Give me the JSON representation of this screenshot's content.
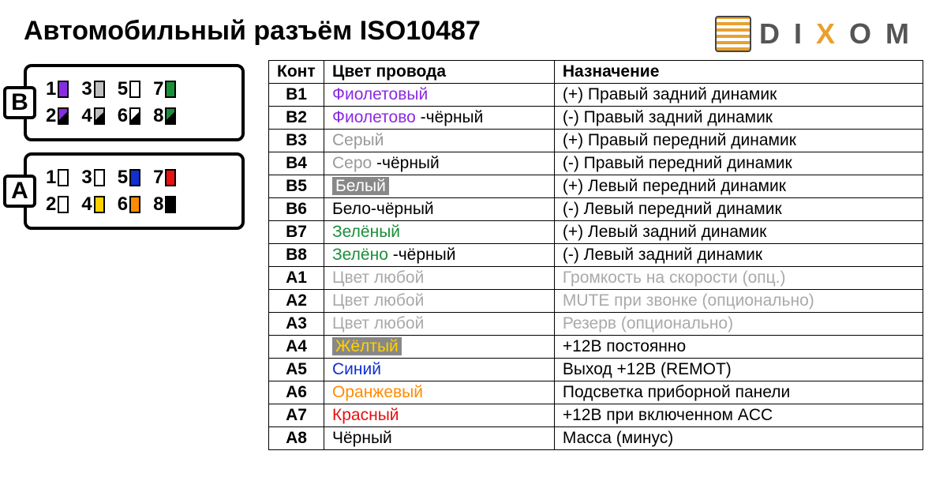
{
  "title": "Автомобильный разъём ISO10487",
  "brand": {
    "d": "D",
    "i": "I",
    "x": "X",
    "o": "O",
    "m": "M"
  },
  "connectors": {
    "B": {
      "label": "B",
      "row1": [
        {
          "n": "1",
          "fill": "#8a2be2"
        },
        {
          "n": "3",
          "fill": "#bfbfbf"
        },
        {
          "n": "5",
          "fill": "#ffffff"
        },
        {
          "n": "7",
          "fill": "#1a8f3a"
        }
      ],
      "row2": [
        {
          "n": "2",
          "fill": "#8a2be2",
          "half": "#000"
        },
        {
          "n": "4",
          "fill": "#bfbfbf",
          "half": "#000"
        },
        {
          "n": "6",
          "fill": "#ffffff",
          "half": "#000"
        },
        {
          "n": "8",
          "fill": "#1a8f3a",
          "half": "#000"
        }
      ]
    },
    "A": {
      "label": "A",
      "row1": [
        {
          "n": "1",
          "fill": "#ffffff"
        },
        {
          "n": "3",
          "fill": "#ffffff"
        },
        {
          "n": "5",
          "fill": "#1030d0"
        },
        {
          "n": "7",
          "fill": "#e81010"
        }
      ],
      "row2": [
        {
          "n": "2",
          "fill": "#ffffff"
        },
        {
          "n": "4",
          "fill": "#ffd000"
        },
        {
          "n": "6",
          "fill": "#ff8c00"
        },
        {
          "n": "8",
          "fill": "#000000"
        }
      ]
    }
  },
  "table": {
    "headers": {
      "pin": "Конт",
      "color": "Цвет провода",
      "func": "Назначение"
    },
    "rows": [
      {
        "pin": "B1",
        "color_html": "<span style='color:#8a2be2'>Фиолетовый</span>",
        "func": "(+) Правый задний динамик"
      },
      {
        "pin": "B2",
        "color_html": "<span style='color:#8a2be2'>Фиолетово </span>-чёрный",
        "func": "(-)  Правый задний динамик"
      },
      {
        "pin": "B3",
        "color_html": "<span style='color:#999'>Серый</span>",
        "func": "(+) Правый передний динамик"
      },
      {
        "pin": "B4",
        "color_html": "<span style='color:#999'>Серо </span>-чёрный",
        "func": "(-)  Правый передний динамик"
      },
      {
        "pin": "B5",
        "color_html": "<span class='hl'>Белый</span>",
        "func": "(+) Левый передний динамик"
      },
      {
        "pin": "B6",
        "color_html": "Бело-чёрный",
        "func": "(-)  Левый передний динамик"
      },
      {
        "pin": "B7",
        "color_html": "<span style='color:#1a8f3a'>Зелёный</span>",
        "func": "(+) Левый задний динамик"
      },
      {
        "pin": "B8",
        "color_html": "<span style='color:#1a8f3a'>Зелёно </span>-чёрный",
        "func": "(-)  Левый задний динамик"
      },
      {
        "pin": "A1",
        "color_html": "<span class='muted'>Цвет любой</span>",
        "func_html": "<span class='muted'>Громкость на скорости (опц.)</span>"
      },
      {
        "pin": "A2",
        "color_html": "<span class='muted'>Цвет любой</span>",
        "func_html": "<span class='muted'>MUTE при звонке (опционально)</span>"
      },
      {
        "pin": "A3",
        "color_html": "<span class='muted'>Цвет любой</span>",
        "func_html": "<span class='muted'>Резерв (опционально)</span>"
      },
      {
        "pin": "A4",
        "color_html": "<span class='hl' style='background:#888;color:#ffd000'>Жёлтый</span>",
        "func": "+12В постоянно"
      },
      {
        "pin": "A5",
        "color_html": "<span style='color:#1030d0'>Синий</span>",
        "func": "Выход +12В (REMOT)"
      },
      {
        "pin": "A6",
        "color_html": "<span style='color:#ff8c00'>Оранжевый</span>",
        "func": "Подсветка приборной панели"
      },
      {
        "pin": "A7",
        "color_html": "<span style='color:#e81010'>Красный</span>",
        "func": "+12В при включенном ACC"
      },
      {
        "pin": "A8",
        "color_html": "Чёрный",
        "func": "Масса (минус)"
      }
    ]
  }
}
